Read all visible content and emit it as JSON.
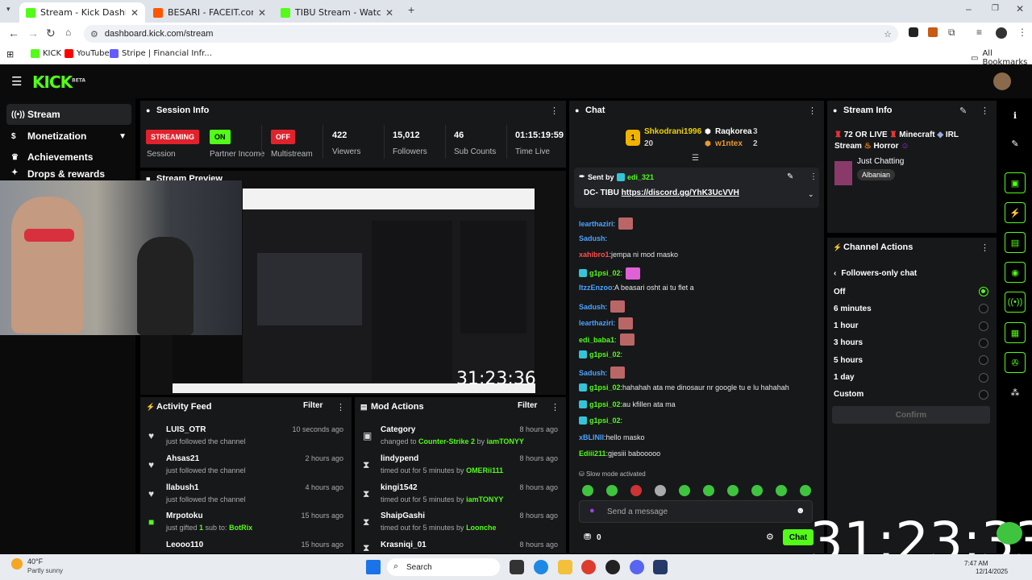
{
  "browser": {
    "tabs": [
      {
        "title": "Stream - Kick Dashboard",
        "active": true,
        "color": "#53fc18"
      },
      {
        "title": "BESARI - FACEIT.com",
        "active": false,
        "color": "#ff5500"
      },
      {
        "title": "TIBU Stream - Watch Live on Ki",
        "active": false,
        "color": "#53fc18"
      }
    ],
    "url": "dashboard.kick.com/stream",
    "bookmarks": [
      "KICK",
      "YouTube",
      "Stripe | Financial Infr..."
    ],
    "all_bookmarks": "All Bookmarks"
  },
  "kick": {
    "logo": "KICK",
    "beta": "BETA"
  },
  "sidebar": {
    "items": [
      {
        "label": "Stream",
        "icon": "stream-icon"
      },
      {
        "label": "Monetization",
        "icon": "dollar-icon"
      },
      {
        "label": "Achievements",
        "icon": "trophy-icon"
      },
      {
        "label": "Drops & rewards",
        "icon": "gift-icon"
      }
    ]
  },
  "session": {
    "title": "Session Info",
    "streaming_badge": "STREAMING",
    "streaming_label": "Session",
    "partner_badge": "ON",
    "partner_label": "Partner Income",
    "multistream_badge": "OFF",
    "multistream_label": "Multistream",
    "viewers": "422",
    "viewers_label": "Viewers",
    "followers": "15,012",
    "followers_label": "Followers",
    "subs": "46",
    "subs_label": "Sub Counts",
    "time": "01:15:19:59",
    "time_label": "Time Live"
  },
  "preview": {
    "title": "Stream Preview",
    "overlay_timer": "31:23:36"
  },
  "activity": {
    "title": "Activity Feed",
    "filter": "Filter",
    "rows": [
      {
        "name": "LUIS_OTR",
        "desc": "just followed the channel",
        "time": "10 seconds ago"
      },
      {
        "name": "Ahsas21",
        "desc": "just followed the channel",
        "time": "2 hours ago"
      },
      {
        "name": "llabush1",
        "desc": "just followed the channel",
        "time": "4 hours ago"
      },
      {
        "name": "Mrpotoku",
        "desc_pre": "just gifted ",
        "desc_num": "1",
        "desc_mid": " sub to: ",
        "desc_user": "BotRix",
        "time": "15 hours ago"
      },
      {
        "name": "Leooo110",
        "time": "15 hours ago"
      }
    ]
  },
  "mod": {
    "title": "Mod Actions",
    "filter": "Filter",
    "rows": [
      {
        "name": "Category",
        "pre": "changed to ",
        "hl": "Counter-Strike 2",
        "mid": " by ",
        "by": "iamTONYY",
        "time": "8 hours ago"
      },
      {
        "name": "lindypend",
        "pre": "timed out for 5 minutes by ",
        "hl": "",
        "mid": "",
        "by": "OMERii111",
        "time": "8 hours ago"
      },
      {
        "name": "kingi1542",
        "pre": "timed out for 5 minutes by ",
        "hl": "",
        "mid": "",
        "by": "iamTONYY",
        "time": "8 hours ago"
      },
      {
        "name": "ShaipGashi",
        "pre": "timed out for 5 minutes by ",
        "hl": "",
        "mid": "",
        "by": "Loonche",
        "time": "8 hours ago"
      },
      {
        "name": "Krasniqi_01",
        "time": "8 hours ago"
      }
    ]
  },
  "chat": {
    "title": "Chat",
    "top": {
      "rank": "1",
      "user1": "Shkodrani1996",
      "count1": "20",
      "user2": "Raqkorea",
      "count2": "3",
      "user3": "w1ntex",
      "count3": "2"
    },
    "pinned": {
      "sent_by": "Sent by",
      "user": "edi_321",
      "message": "DC- TIBU ",
      "link": "https://discord.gg/YhK3UcVVH"
    },
    "messages": [
      {
        "user": "learthaziri",
        "color": "#4aa3ff",
        "text": "",
        "emote": true
      },
      {
        "user": "Sadush",
        "color": "#4aa3ff",
        "text": ""
      },
      {
        "user": "xahibro1",
        "color": "#ff4d4d",
        "text": "jempa ni mod masko"
      },
      {
        "user": "g1psi_02",
        "color": "#53fc18",
        "text": "",
        "emote": "p",
        "badge": true
      },
      {
        "user": "ItzzEnzoo",
        "color": "#4aa3ff",
        "text": "A beasari osht ai tu flet a"
      },
      {
        "user": "Sadush",
        "color": "#4aa3ff",
        "text": "",
        "emote": true
      },
      {
        "user": "learthaziri",
        "color": "#4aa3ff",
        "text": "",
        "emote": true
      },
      {
        "user": "edi_baba1",
        "color": "#53fc18",
        "text": "",
        "emote": true
      },
      {
        "user": "g1psi_02",
        "color": "#53fc18",
        "text": "",
        "badge": true
      },
      {
        "user": "Sadush",
        "color": "#4aa3ff",
        "text": "",
        "emote": true
      },
      {
        "user": "g1psi_02",
        "color": "#53fc18",
        "text": "hahahah ata me dinosaur nr google tu e lu hahahah",
        "badge": true
      },
      {
        "user": "g1psi_02",
        "color": "#53fc18",
        "text": "au kfillen ata ma",
        "badge": true
      },
      {
        "user": "g1psi_02",
        "color": "#53fc18",
        "text": "",
        "badge": true
      },
      {
        "user": "xBLINII",
        "color": "#4aa3ff",
        "text": "hello masko"
      },
      {
        "user": "Ediii211",
        "color": "#53fc18",
        "text": "gjesiii babooooo"
      }
    ],
    "slow_mode": "Slow mode activated",
    "placeholder": "Send a message",
    "points": "0",
    "send": "Chat"
  },
  "stream_info": {
    "title": "Stream Info",
    "text1": "72 OR LIVE",
    "text2": "Minecraft",
    "text3": "IRL",
    "text4": "Stream",
    "text5": "Horror",
    "category": "Just Chatting",
    "tag": "Albanian"
  },
  "channel_actions": {
    "title": "Channel Actions",
    "sub": "Followers-only chat",
    "options": [
      "Off",
      "6 minutes",
      "1 hour",
      "3 hours",
      "5 hours",
      "1 day",
      "Custom"
    ],
    "selected": 0,
    "confirm": "Confirm"
  },
  "overlay_clock": "31:23:33",
  "taskbar": {
    "weather_temp": "40°F",
    "weather_desc": "Partly sunny",
    "search": "Search",
    "time": "7:47 AM",
    "date": "12/14/2025"
  }
}
